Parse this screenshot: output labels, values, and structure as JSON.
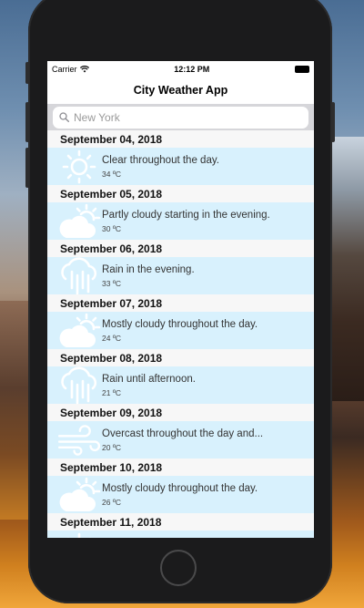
{
  "status_bar": {
    "carrier": "Carrier",
    "time": "12:12 PM"
  },
  "nav": {
    "title": "City Weather App"
  },
  "search": {
    "placeholder": "New York"
  },
  "days": [
    {
      "date": "September 04, 2018",
      "icon": "sun-icon",
      "summary": "Clear throughout the day.",
      "temp": "34 ºC"
    },
    {
      "date": "September 05, 2018",
      "icon": "partly-cloudy-icon",
      "summary": "Partly cloudy starting in the evening.",
      "temp": "30 ºC"
    },
    {
      "date": "September 06, 2018",
      "icon": "rain-icon",
      "summary": "Rain in the evening.",
      "temp": "33 ºC"
    },
    {
      "date": "September 07, 2018",
      "icon": "partly-cloudy-icon",
      "summary": "Mostly cloudy throughout the day.",
      "temp": "24 ºC"
    },
    {
      "date": "September 08, 2018",
      "icon": "rain-icon",
      "summary": "Rain until afternoon.",
      "temp": "21 ºC"
    },
    {
      "date": "September 09, 2018",
      "icon": "wind-icon",
      "summary": "Overcast throughout the day and...",
      "temp": "20 ºC"
    },
    {
      "date": "September 10, 2018",
      "icon": "partly-cloudy-icon",
      "summary": "Mostly cloudy throughout the day.",
      "temp": "26 ºC"
    },
    {
      "date": "September 11, 2018",
      "icon": "sun-icon",
      "summary": "",
      "temp": ""
    }
  ]
}
